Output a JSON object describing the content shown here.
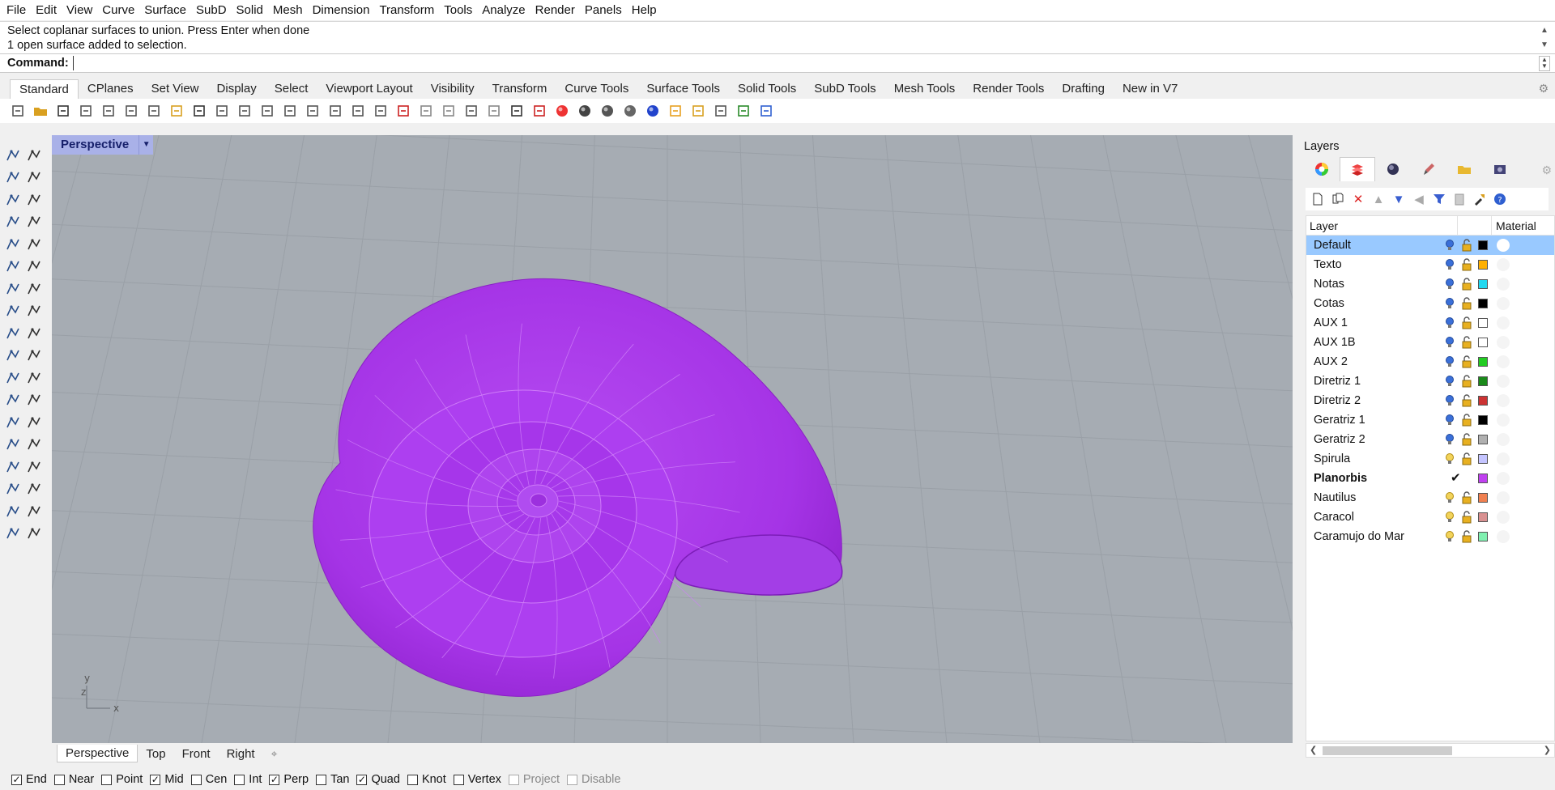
{
  "menu": [
    "File",
    "Edit",
    "View",
    "Curve",
    "Surface",
    "SubD",
    "Solid",
    "Mesh",
    "Dimension",
    "Transform",
    "Tools",
    "Analyze",
    "Render",
    "Panels",
    "Help"
  ],
  "history": {
    "line1": "Select coplanar surfaces to union. Press Enter when done",
    "line2": "1 open surface added to selection."
  },
  "command": {
    "label": "Command:",
    "value": ""
  },
  "toolbar_tabs": [
    "Standard",
    "CPlanes",
    "Set View",
    "Display",
    "Select",
    "Viewport Layout",
    "Visibility",
    "Transform",
    "Curve Tools",
    "Surface Tools",
    "Solid Tools",
    "SubD Tools",
    "Mesh Tools",
    "Render Tools",
    "Drafting",
    "New in V7"
  ],
  "active_toolbar_tab": "Standard",
  "viewport": {
    "title": "Perspective",
    "axis_x": "x",
    "axis_y": "y",
    "axis_z": "z",
    "object_color": "#b040f0"
  },
  "viewport_tabs": [
    "Perspective",
    "Top",
    "Front",
    "Right"
  ],
  "layers_panel": {
    "title": "Layers",
    "col_layer": "Layer",
    "col_material": "Material",
    "rows": [
      {
        "name": "Default",
        "color": "#000000",
        "selected": true
      },
      {
        "name": "Texto",
        "color": "#ffb000"
      },
      {
        "name": "Notas",
        "color": "#22d8f0"
      },
      {
        "name": "Cotas",
        "color": "#000000"
      },
      {
        "name": "AUX 1",
        "color": "#ffffff"
      },
      {
        "name": "AUX 1B",
        "color": "#ffffff"
      },
      {
        "name": "AUX 2",
        "color": "#22cc22"
      },
      {
        "name": "Diretriz 1",
        "color": "#1a8a1a"
      },
      {
        "name": "Diretriz 2",
        "color": "#cc3333"
      },
      {
        "name": "Geratriz 1",
        "color": "#000000"
      },
      {
        "name": "Geratriz 2",
        "color": "#b0b0b0"
      },
      {
        "name": "Spirula",
        "color": "#c4c4ff"
      },
      {
        "name": "Planorbis",
        "color": "#c040f0",
        "current": true
      },
      {
        "name": "Nautilus",
        "color": "#f08050"
      },
      {
        "name": "Caracol",
        "color": "#d89090"
      },
      {
        "name": "Caramujo do Mar",
        "color": "#80f0b0"
      }
    ]
  },
  "osnaps": [
    {
      "label": "End",
      "checked": true
    },
    {
      "label": "Near",
      "checked": false
    },
    {
      "label": "Point",
      "checked": false
    },
    {
      "label": "Mid",
      "checked": true
    },
    {
      "label": "Cen",
      "checked": false
    },
    {
      "label": "Int",
      "checked": false
    },
    {
      "label": "Perp",
      "checked": true
    },
    {
      "label": "Tan",
      "checked": false
    },
    {
      "label": "Quad",
      "checked": true
    },
    {
      "label": "Knot",
      "checked": false
    },
    {
      "label": "Vertex",
      "checked": false
    },
    {
      "label": "Project",
      "checked": false,
      "disabled": true
    },
    {
      "label": "Disable",
      "checked": false,
      "disabled": true
    }
  ]
}
